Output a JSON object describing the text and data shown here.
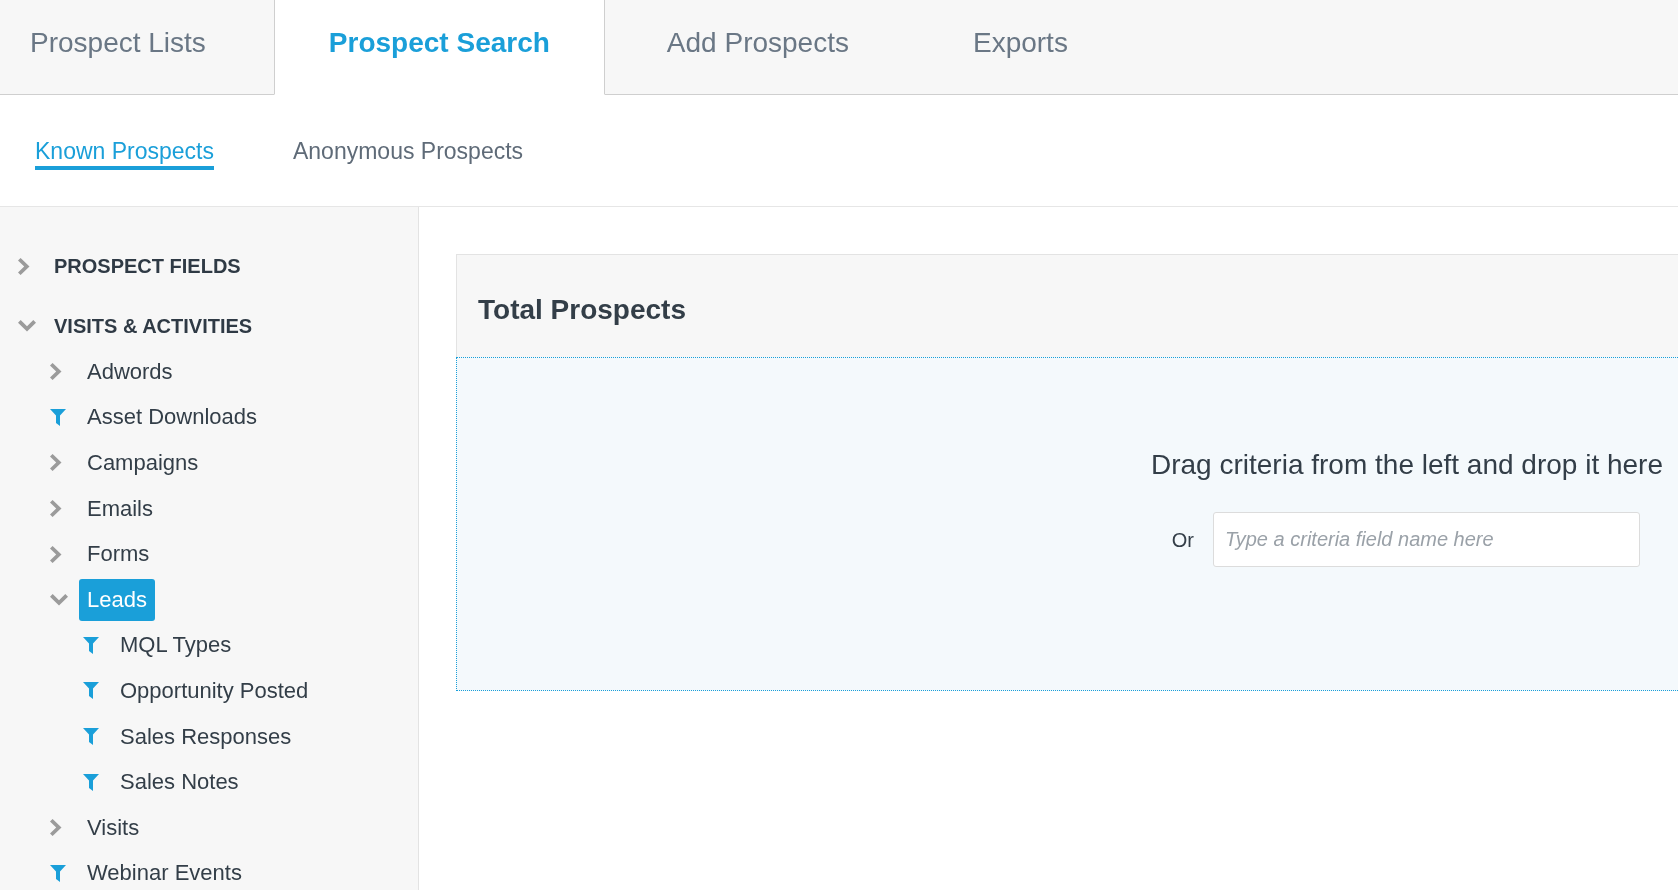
{
  "tabs": [
    {
      "label": "Prospect Lists",
      "selected": false
    },
    {
      "label": "Prospect Search",
      "selected": true
    },
    {
      "label": "Add Prospects",
      "selected": false
    },
    {
      "label": "Exports",
      "selected": false
    }
  ],
  "subtabs": [
    {
      "label": "Known Prospects",
      "selected": true
    },
    {
      "label": "Anonymous Prospects",
      "selected": false
    }
  ],
  "sidebar": {
    "sections": [
      {
        "label": "PROSPECT FIELDS",
        "expanded": false
      },
      {
        "label": "VISITS & ACTIVITIES",
        "expanded": true,
        "children": [
          {
            "label": "Adwords",
            "kind": "folder",
            "expanded": false,
            "selected": false
          },
          {
            "label": "Asset Downloads",
            "kind": "filter",
            "selected": false
          },
          {
            "label": "Campaigns",
            "kind": "folder",
            "expanded": false,
            "selected": false
          },
          {
            "label": "Emails",
            "kind": "folder",
            "expanded": false,
            "selected": false
          },
          {
            "label": "Forms",
            "kind": "folder",
            "expanded": false,
            "selected": false
          },
          {
            "label": "Leads",
            "kind": "folder",
            "expanded": true,
            "selected": true,
            "children": [
              {
                "label": "MQL Types",
                "kind": "filter",
                "selected": false
              },
              {
                "label": "Opportunity Posted",
                "kind": "filter",
                "selected": false
              },
              {
                "label": "Sales Responses",
                "kind": "filter",
                "selected": false
              },
              {
                "label": "Sales Notes",
                "kind": "filter",
                "selected": false
              }
            ]
          },
          {
            "label": "Visits",
            "kind": "folder",
            "expanded": false,
            "selected": false
          },
          {
            "label": "Webinar Events",
            "kind": "filter",
            "selected": false
          }
        ]
      }
    ]
  },
  "panel": {
    "title": "Total Prospects",
    "drop_zone": {
      "prompt": "Drag criteria from the left and drop it here",
      "or_label": "Or",
      "search": {
        "placeholder": "Type a criteria field name here"
      }
    }
  }
}
